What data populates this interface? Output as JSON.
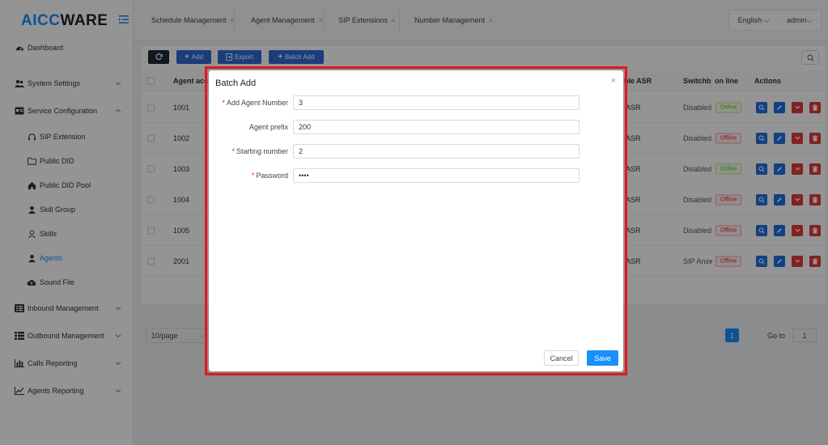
{
  "brand": {
    "part1": "AICC",
    "part2": "WARE"
  },
  "sidebar": {
    "items": [
      {
        "label": "Dashboard"
      },
      {
        "label": "System Settings"
      },
      {
        "label": "Service Configuration"
      },
      {
        "label": "SIP Extension"
      },
      {
        "label": "Public DID"
      },
      {
        "label": "Public DID Pool"
      },
      {
        "label": "Skill Group"
      },
      {
        "label": "Skills"
      },
      {
        "label": "Agents"
      },
      {
        "label": "Sound File"
      },
      {
        "label": "Inbound Management"
      },
      {
        "label": "Outbound Management"
      },
      {
        "label": "Calls Reporting"
      },
      {
        "label": "Agents Reporting"
      }
    ]
  },
  "tabs": [
    {
      "label": "Schedule Management",
      "close": "×"
    },
    {
      "label": "Agent Management",
      "close": "×"
    },
    {
      "label": "SIP Extensions",
      "close": "×"
    },
    {
      "label": "Number Management",
      "close": "×"
    }
  ],
  "topbar": {
    "language": "English",
    "user": "admin"
  },
  "toolbar": {
    "add": "Add",
    "export": "Export",
    "batch_add": "Batch Add"
  },
  "table": {
    "headers": {
      "account": "Agent acc",
      "asr": "ble ASR",
      "switchboard": "Switchb",
      "online": "on line",
      "actions": "Actions"
    },
    "rows": [
      {
        "account": "1001",
        "asr": "ASR",
        "switchboard": "Disabled",
        "status": "Online"
      },
      {
        "account": "1002",
        "asr": "ASR",
        "switchboard": "Disabled",
        "status": "Offline"
      },
      {
        "account": "1003",
        "asr": "ASR",
        "switchboard": "Disabled",
        "status": "Online"
      },
      {
        "account": "1004",
        "asr": "ASR",
        "switchboard": "Disabled",
        "status": "Offline"
      },
      {
        "account": "1005",
        "asr": "ASR",
        "switchboard": "Disabled",
        "status": "Offline"
      },
      {
        "account": "2001",
        "asr": "ASR",
        "switchboard": "SIP Answ",
        "status": "Offline"
      }
    ]
  },
  "pagination": {
    "page_size": "10/page",
    "current_page": "1",
    "goto_label": "Go to",
    "goto_value": "1"
  },
  "modal": {
    "title": "Batch Add",
    "close": "×",
    "fields": [
      {
        "label": "Add Agent Number",
        "required": true,
        "value": "3"
      },
      {
        "label": "Agent prefix",
        "required": false,
        "value": "200"
      },
      {
        "label": "Starting number",
        "required": true,
        "value": "2"
      },
      {
        "label": "Password",
        "required": true,
        "value": "1234"
      }
    ],
    "cancel": "Cancel",
    "save": "Save"
  },
  "colors": {
    "accent": "#1890ff",
    "highlight_border": "#e8161c",
    "danger": "#e13c3c"
  }
}
